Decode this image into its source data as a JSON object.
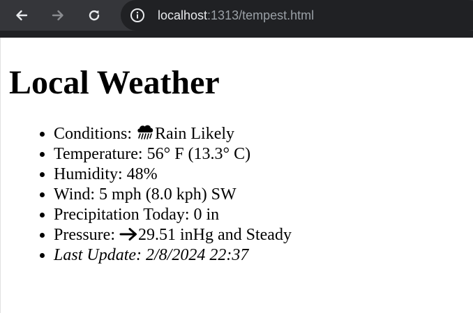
{
  "browser": {
    "url_host": "localhost",
    "url_path": ":1313/tempest.html"
  },
  "page": {
    "heading": "Local Weather",
    "items": {
      "conditions": {
        "label": "Conditions: ",
        "value": "Rain Likely",
        "icon": "cloud-rain-icon"
      },
      "temperature": {
        "label": "Temperature: ",
        "value": "56° F (13.3° C)"
      },
      "humidity": {
        "label": "Humidity: ",
        "value": "48%"
      },
      "wind": {
        "label": "Wind: ",
        "value": "5 mph (8.0 kph) SW"
      },
      "precipitation": {
        "label": "Precipitation Today: ",
        "value": "0 in"
      },
      "pressure": {
        "label": "Pressure: ",
        "value": "29.51 inHg and Steady",
        "icon": "arrow-right-icon"
      },
      "last_update": {
        "label": "Last Update: ",
        "value": "2/8/2024 22:37"
      }
    }
  }
}
